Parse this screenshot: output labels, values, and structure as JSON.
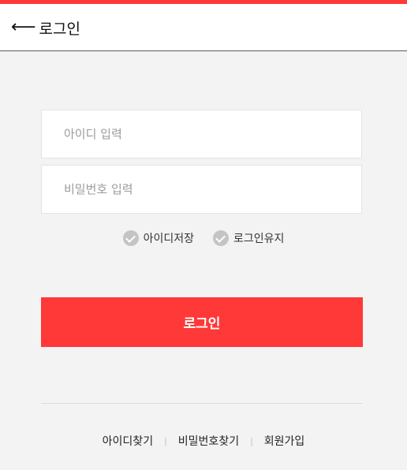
{
  "header": {
    "back_icon": "left-arrow-icon",
    "title": "로그인"
  },
  "form": {
    "id_placeholder": "아이디 입력",
    "password_placeholder": "비밀번호 입력",
    "save_id_label": "아이디저장",
    "keep_login_label": "로그인유지",
    "submit_label": "로그인"
  },
  "footer": {
    "find_id": "아이디찾기",
    "find_password": "비밀번호찾기",
    "signup": "회원가입",
    "separator": "|"
  },
  "colors": {
    "accent": "#ff3838",
    "background": "#f3f3f3",
    "checkbox": "#c4c4c4"
  }
}
